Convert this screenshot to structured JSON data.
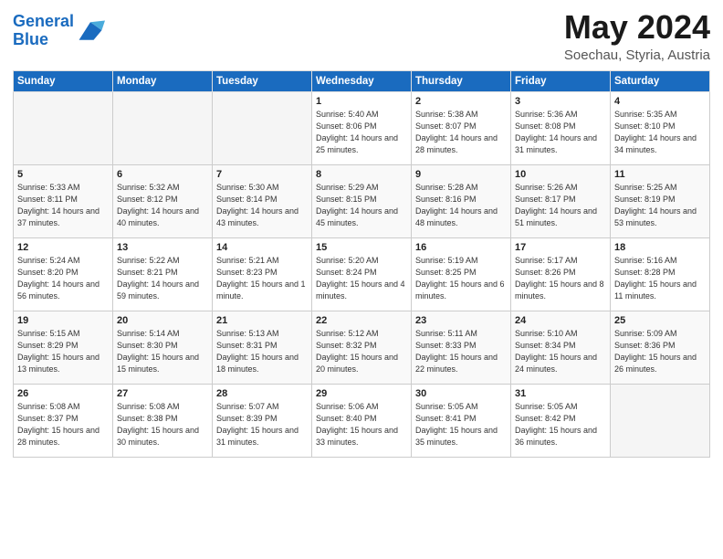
{
  "header": {
    "logo_line1": "General",
    "logo_line2": "Blue",
    "month": "May 2024",
    "location": "Soechau, Styria, Austria"
  },
  "weekdays": [
    "Sunday",
    "Monday",
    "Tuesday",
    "Wednesday",
    "Thursday",
    "Friday",
    "Saturday"
  ],
  "weeks": [
    [
      {
        "day": "",
        "sunrise": "",
        "sunset": "",
        "daylight": ""
      },
      {
        "day": "",
        "sunrise": "",
        "sunset": "",
        "daylight": ""
      },
      {
        "day": "",
        "sunrise": "",
        "sunset": "",
        "daylight": ""
      },
      {
        "day": "1",
        "sunrise": "Sunrise: 5:40 AM",
        "sunset": "Sunset: 8:06 PM",
        "daylight": "Daylight: 14 hours and 25 minutes."
      },
      {
        "day": "2",
        "sunrise": "Sunrise: 5:38 AM",
        "sunset": "Sunset: 8:07 PM",
        "daylight": "Daylight: 14 hours and 28 minutes."
      },
      {
        "day": "3",
        "sunrise": "Sunrise: 5:36 AM",
        "sunset": "Sunset: 8:08 PM",
        "daylight": "Daylight: 14 hours and 31 minutes."
      },
      {
        "day": "4",
        "sunrise": "Sunrise: 5:35 AM",
        "sunset": "Sunset: 8:10 PM",
        "daylight": "Daylight: 14 hours and 34 minutes."
      }
    ],
    [
      {
        "day": "5",
        "sunrise": "Sunrise: 5:33 AM",
        "sunset": "Sunset: 8:11 PM",
        "daylight": "Daylight: 14 hours and 37 minutes."
      },
      {
        "day": "6",
        "sunrise": "Sunrise: 5:32 AM",
        "sunset": "Sunset: 8:12 PM",
        "daylight": "Daylight: 14 hours and 40 minutes."
      },
      {
        "day": "7",
        "sunrise": "Sunrise: 5:30 AM",
        "sunset": "Sunset: 8:14 PM",
        "daylight": "Daylight: 14 hours and 43 minutes."
      },
      {
        "day": "8",
        "sunrise": "Sunrise: 5:29 AM",
        "sunset": "Sunset: 8:15 PM",
        "daylight": "Daylight: 14 hours and 45 minutes."
      },
      {
        "day": "9",
        "sunrise": "Sunrise: 5:28 AM",
        "sunset": "Sunset: 8:16 PM",
        "daylight": "Daylight: 14 hours and 48 minutes."
      },
      {
        "day": "10",
        "sunrise": "Sunrise: 5:26 AM",
        "sunset": "Sunset: 8:17 PM",
        "daylight": "Daylight: 14 hours and 51 minutes."
      },
      {
        "day": "11",
        "sunrise": "Sunrise: 5:25 AM",
        "sunset": "Sunset: 8:19 PM",
        "daylight": "Daylight: 14 hours and 53 minutes."
      }
    ],
    [
      {
        "day": "12",
        "sunrise": "Sunrise: 5:24 AM",
        "sunset": "Sunset: 8:20 PM",
        "daylight": "Daylight: 14 hours and 56 minutes."
      },
      {
        "day": "13",
        "sunrise": "Sunrise: 5:22 AM",
        "sunset": "Sunset: 8:21 PM",
        "daylight": "Daylight: 14 hours and 59 minutes."
      },
      {
        "day": "14",
        "sunrise": "Sunrise: 5:21 AM",
        "sunset": "Sunset: 8:23 PM",
        "daylight": "Daylight: 15 hours and 1 minute."
      },
      {
        "day": "15",
        "sunrise": "Sunrise: 5:20 AM",
        "sunset": "Sunset: 8:24 PM",
        "daylight": "Daylight: 15 hours and 4 minutes."
      },
      {
        "day": "16",
        "sunrise": "Sunrise: 5:19 AM",
        "sunset": "Sunset: 8:25 PM",
        "daylight": "Daylight: 15 hours and 6 minutes."
      },
      {
        "day": "17",
        "sunrise": "Sunrise: 5:17 AM",
        "sunset": "Sunset: 8:26 PM",
        "daylight": "Daylight: 15 hours and 8 minutes."
      },
      {
        "day": "18",
        "sunrise": "Sunrise: 5:16 AM",
        "sunset": "Sunset: 8:28 PM",
        "daylight": "Daylight: 15 hours and 11 minutes."
      }
    ],
    [
      {
        "day": "19",
        "sunrise": "Sunrise: 5:15 AM",
        "sunset": "Sunset: 8:29 PM",
        "daylight": "Daylight: 15 hours and 13 minutes."
      },
      {
        "day": "20",
        "sunrise": "Sunrise: 5:14 AM",
        "sunset": "Sunset: 8:30 PM",
        "daylight": "Daylight: 15 hours and 15 minutes."
      },
      {
        "day": "21",
        "sunrise": "Sunrise: 5:13 AM",
        "sunset": "Sunset: 8:31 PM",
        "daylight": "Daylight: 15 hours and 18 minutes."
      },
      {
        "day": "22",
        "sunrise": "Sunrise: 5:12 AM",
        "sunset": "Sunset: 8:32 PM",
        "daylight": "Daylight: 15 hours and 20 minutes."
      },
      {
        "day": "23",
        "sunrise": "Sunrise: 5:11 AM",
        "sunset": "Sunset: 8:33 PM",
        "daylight": "Daylight: 15 hours and 22 minutes."
      },
      {
        "day": "24",
        "sunrise": "Sunrise: 5:10 AM",
        "sunset": "Sunset: 8:34 PM",
        "daylight": "Daylight: 15 hours and 24 minutes."
      },
      {
        "day": "25",
        "sunrise": "Sunrise: 5:09 AM",
        "sunset": "Sunset: 8:36 PM",
        "daylight": "Daylight: 15 hours and 26 minutes."
      }
    ],
    [
      {
        "day": "26",
        "sunrise": "Sunrise: 5:08 AM",
        "sunset": "Sunset: 8:37 PM",
        "daylight": "Daylight: 15 hours and 28 minutes."
      },
      {
        "day": "27",
        "sunrise": "Sunrise: 5:08 AM",
        "sunset": "Sunset: 8:38 PM",
        "daylight": "Daylight: 15 hours and 30 minutes."
      },
      {
        "day": "28",
        "sunrise": "Sunrise: 5:07 AM",
        "sunset": "Sunset: 8:39 PM",
        "daylight": "Daylight: 15 hours and 31 minutes."
      },
      {
        "day": "29",
        "sunrise": "Sunrise: 5:06 AM",
        "sunset": "Sunset: 8:40 PM",
        "daylight": "Daylight: 15 hours and 33 minutes."
      },
      {
        "day": "30",
        "sunrise": "Sunrise: 5:05 AM",
        "sunset": "Sunset: 8:41 PM",
        "daylight": "Daylight: 15 hours and 35 minutes."
      },
      {
        "day": "31",
        "sunrise": "Sunrise: 5:05 AM",
        "sunset": "Sunset: 8:42 PM",
        "daylight": "Daylight: 15 hours and 36 minutes."
      },
      {
        "day": "",
        "sunrise": "",
        "sunset": "",
        "daylight": ""
      }
    ]
  ]
}
